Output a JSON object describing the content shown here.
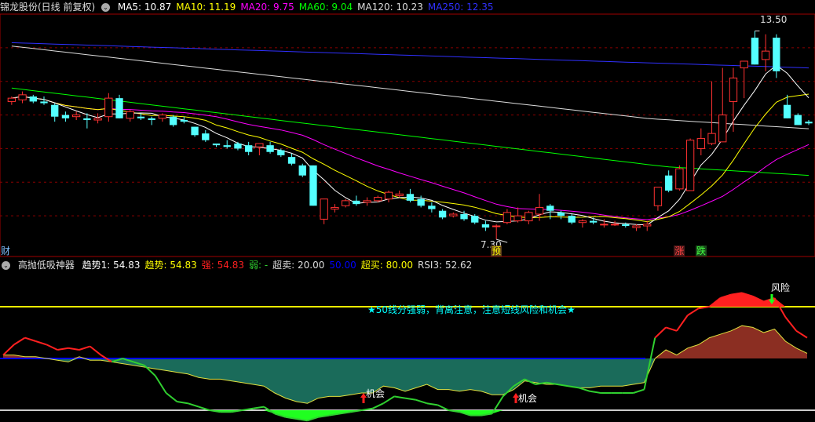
{
  "colors": {
    "up": "#ff3232",
    "down": "#54ffff",
    "ma5": "#ffffff",
    "ma10": "#ffff00",
    "ma20": "#ff00ff",
    "ma60": "#00ff00",
    "ma120": "#dddddd",
    "ma250": "#3030ff",
    "strong": "#ff2020",
    "weak": "#30d030",
    "overbought": "#ffff00",
    "oversold": "#cccccc",
    "mid": "#0000ff",
    "note": "#00ffff"
  },
  "icons": {
    "settings": "circle-arrow-icon"
  },
  "top": {
    "stock_label": "锦龙股份(日线 前复权)",
    "legend": [
      {
        "key": "ma5",
        "text": "MA5: 10.87"
      },
      {
        "key": "ma10",
        "text": "MA10: 11.19"
      },
      {
        "key": "ma20",
        "text": "MA20: 9.75"
      },
      {
        "key": "ma60",
        "text": "MA60: 9.04"
      },
      {
        "key": "ma120",
        "text": "MA120: 10.23"
      },
      {
        "key": "ma250",
        "text": "MA250: 12.35"
      }
    ],
    "high_label": "13.50",
    "low_label": "7.30",
    "side_char": "财",
    "markers": [
      {
        "text": "预",
        "color": "#ffff00",
        "bg": "#5a3a1a",
        "index": 45
      },
      {
        "text": "涨",
        "color": "#ff4040",
        "bg": "#4a1a1a",
        "index": 62
      },
      {
        "text": "跌",
        "color": "#40ff40",
        "bg": "#1a4a1a",
        "index": 64
      }
    ]
  },
  "bottom": {
    "indicator_name": "高抛低吸神器",
    "legend": [
      {
        "key": "trend1",
        "color": "#ffffff",
        "text": "趋势1: 54.83"
      },
      {
        "key": "trend",
        "color": "#ffff00",
        "text": "趋势: 54.83"
      },
      {
        "key": "strong",
        "color": "#ff2020",
        "text": "强: 54.83"
      },
      {
        "key": "weak",
        "color": "#30d030",
        "text": "弱: -"
      },
      {
        "key": "oversold",
        "color": "#dddddd",
        "text": "超卖: 20.00"
      },
      {
        "key": "mid",
        "color": "#0000ff",
        "text": "50.00"
      },
      {
        "key": "overbought",
        "color": "#ffff00",
        "text": "超买: 80.00"
      },
      {
        "key": "rsi3",
        "color": "#dddddd",
        "text": "RSI3: 52.62"
      }
    ],
    "note": "★50线分强弱，背离注意，注意短线风险和机会★",
    "risk_label": "风险",
    "chance_label": "机会"
  },
  "chart_data": [
    {
      "type": "candlestick",
      "ylim": [
        7.0,
        14.0
      ],
      "grid": true,
      "ohlc": [
        [
          11.4,
          11.55,
          11.3,
          11.5
        ],
        [
          11.45,
          11.7,
          11.35,
          11.6
        ],
        [
          11.55,
          11.6,
          11.35,
          11.4
        ],
        [
          11.4,
          11.55,
          11.3,
          11.35
        ],
        [
          11.3,
          11.35,
          10.8,
          10.95
        ],
        [
          11.0,
          11.1,
          10.8,
          10.9
        ],
        [
          10.95,
          11.1,
          10.85,
          11.0
        ],
        [
          10.9,
          11.05,
          10.6,
          10.85
        ],
        [
          10.85,
          11.05,
          10.75,
          10.9
        ],
        [
          10.95,
          11.65,
          10.8,
          11.5
        ],
        [
          11.5,
          11.6,
          10.9,
          10.9
        ],
        [
          10.9,
          11.15,
          10.8,
          11.1
        ],
        [
          10.95,
          11.05,
          10.85,
          10.9
        ],
        [
          10.9,
          10.95,
          10.7,
          10.85
        ],
        [
          10.9,
          11.05,
          10.8,
          11.0
        ],
        [
          10.95,
          11.0,
          10.65,
          10.7
        ],
        [
          10.85,
          10.95,
          10.75,
          10.8
        ],
        [
          10.65,
          10.65,
          10.35,
          10.4
        ],
        [
          10.45,
          10.55,
          10.2,
          10.25
        ],
        [
          10.15,
          10.15,
          10.05,
          10.1
        ],
        [
          10.1,
          10.25,
          10.0,
          10.05
        ],
        [
          10.15,
          10.2,
          9.95,
          10.0
        ],
        [
          10.1,
          10.2,
          9.8,
          9.9
        ],
        [
          10.05,
          10.1,
          9.8,
          10.15
        ],
        [
          10.1,
          10.2,
          9.85,
          9.9
        ],
        [
          9.95,
          10.0,
          9.75,
          9.8
        ],
        [
          9.75,
          9.85,
          9.5,
          9.55
        ],
        [
          9.5,
          9.55,
          9.15,
          9.2
        ],
        [
          9.5,
          9.5,
          8.3,
          8.3
        ],
        [
          7.9,
          8.5,
          7.75,
          8.5
        ],
        [
          8.2,
          8.35,
          8.1,
          8.25
        ],
        [
          8.3,
          8.5,
          8.25,
          8.45
        ],
        [
          8.45,
          8.6,
          8.3,
          8.35
        ],
        [
          8.4,
          8.55,
          8.3,
          8.45
        ],
        [
          8.45,
          8.6,
          8.4,
          8.55
        ],
        [
          8.5,
          8.75,
          8.4,
          8.7
        ],
        [
          8.6,
          8.75,
          8.55,
          8.65
        ],
        [
          8.65,
          8.8,
          8.4,
          8.45
        ],
        [
          8.5,
          8.6,
          8.25,
          8.3
        ],
        [
          8.3,
          8.4,
          8.1,
          8.2
        ],
        [
          8.15,
          8.2,
          7.9,
          7.95
        ],
        [
          8.0,
          8.1,
          7.95,
          8.05
        ],
        [
          8.05,
          8.15,
          7.85,
          7.9
        ],
        [
          8.0,
          8.05,
          7.75,
          7.8
        ],
        [
          7.75,
          7.85,
          7.55,
          7.65
        ],
        [
          7.7,
          7.75,
          7.3,
          7.7
        ],
        [
          7.8,
          8.2,
          7.75,
          8.1
        ],
        [
          7.85,
          8.25,
          7.8,
          8.0
        ],
        [
          7.85,
          8.15,
          7.75,
          8.1
        ],
        [
          8.05,
          8.65,
          7.85,
          8.25
        ],
        [
          8.3,
          8.35,
          7.9,
          8.15
        ],
        [
          8.1,
          8.15,
          7.9,
          8.0
        ],
        [
          8.0,
          8.05,
          7.75,
          7.8
        ],
        [
          7.8,
          7.9,
          7.65,
          7.85
        ],
        [
          7.85,
          7.95,
          7.75,
          7.8
        ],
        [
          7.75,
          7.9,
          7.65,
          7.75
        ],
        [
          7.75,
          7.85,
          7.7,
          7.75
        ],
        [
          7.75,
          7.8,
          7.65,
          7.7
        ],
        [
          7.65,
          7.75,
          7.55,
          7.7
        ],
        [
          7.7,
          7.85,
          7.55,
          7.75
        ],
        [
          8.3,
          8.85,
          8.15,
          8.85
        ],
        [
          9.2,
          9.35,
          8.7,
          8.75
        ],
        [
          8.8,
          9.5,
          8.75,
          9.4
        ],
        [
          8.75,
          10.3,
          8.75,
          10.25
        ],
        [
          10.0,
          10.6,
          9.8,
          10.3
        ],
        [
          10.15,
          12.0,
          10.1,
          10.45
        ],
        [
          10.2,
          12.4,
          10.2,
          11.0
        ],
        [
          11.4,
          12.4,
          10.5,
          12.1
        ],
        [
          12.4,
          12.6,
          11.5,
          12.6
        ],
        [
          13.3,
          13.5,
          12.5,
          12.5
        ],
        [
          12.65,
          13.4,
          12.3,
          12.9
        ],
        [
          13.3,
          13.4,
          12.1,
          12.3
        ],
        [
          11.3,
          11.6,
          10.9,
          10.9
        ],
        [
          11.0,
          11.05,
          10.7,
          10.7
        ],
        [
          10.8,
          10.85,
          10.7,
          10.75
        ]
      ]
    },
    {
      "type": "area",
      "ylim": [
        15,
        100
      ],
      "levels": {
        "oversold": 20,
        "mid": 50,
        "overbought": 80
      },
      "trend1": [
        52,
        52,
        51,
        51,
        50,
        49,
        48,
        51,
        49,
        49,
        48,
        47,
        46,
        45,
        44,
        43,
        42,
        41,
        39,
        38,
        38,
        37,
        36,
        35,
        34,
        30,
        27,
        25,
        24,
        27,
        28,
        28,
        29,
        30,
        30,
        34,
        33,
        31,
        33,
        35,
        32,
        32,
        31,
        32,
        31,
        29,
        29,
        32,
        37,
        36,
        35,
        35,
        34,
        33,
        33,
        34,
        34,
        34,
        35,
        36,
        50,
        55,
        52,
        56,
        58,
        62,
        64,
        66,
        69,
        68,
        65,
        67,
        60,
        56,
        53
      ],
      "rsi3": [
        52,
        58,
        62,
        60,
        58,
        55,
        56,
        55,
        57,
        52,
        48,
        50,
        48,
        46,
        40,
        30,
        25,
        24,
        22,
        20,
        19,
        19,
        20,
        21,
        22,
        18,
        16,
        15,
        14,
        16,
        17,
        18,
        19,
        20,
        21,
        24,
        28,
        27,
        26,
        24,
        23,
        20,
        19,
        17,
        17,
        18,
        28,
        34,
        38,
        35,
        36,
        35,
        34,
        33,
        31,
        30,
        30,
        30,
        30,
        32,
        62,
        68,
        66,
        75,
        79,
        80,
        85,
        87,
        88,
        86,
        83,
        85,
        74,
        66,
        62
      ]
    }
  ]
}
